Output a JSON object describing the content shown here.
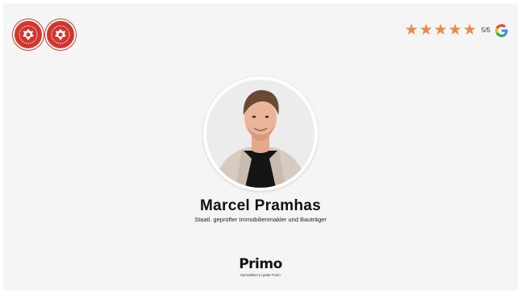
{
  "header": {
    "badges": [
      {
        "icon": "award-seal-icon"
      },
      {
        "icon": "award-seal-icon"
      }
    ],
    "rating": {
      "stars": 5,
      "max_stars": 5,
      "score_text": "5/5",
      "star_color": "#f0874a",
      "source_icon": "google-g-icon"
    }
  },
  "profile": {
    "name": "Marcel Pramhas",
    "job_title": "Staatl. geprüfter Immobilienmakler und Bauträger"
  },
  "footer": {
    "logo_text": "Primo",
    "tagline": "Immobilien in jeder Form"
  },
  "colors": {
    "background": "#f5f5f5",
    "badge_red": "#d3342c",
    "accent_orange": "#f0874a"
  }
}
